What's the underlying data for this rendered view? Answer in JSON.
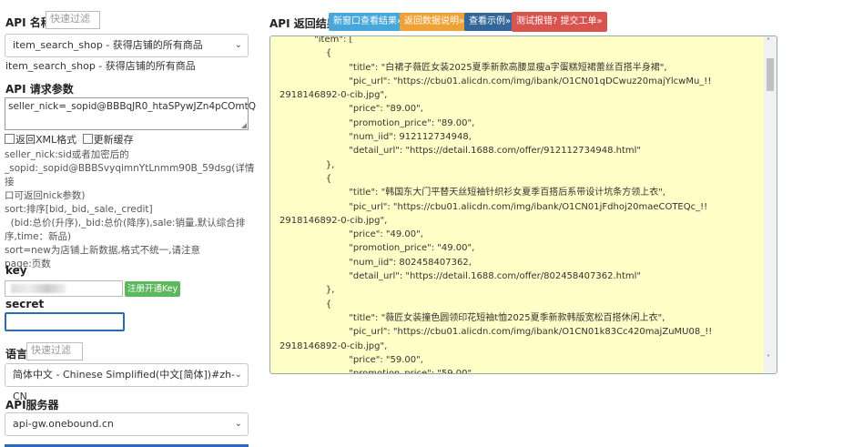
{
  "api_name": {
    "label": "API 名称",
    "filter_placeholder": "快速过滤",
    "selected": "item_search_shop - 获得店铺的所有商品",
    "description": "item_search_shop - 获得店铺的所有商品"
  },
  "params": {
    "label": "API 请求参数",
    "value": "seller_nick=_sopid@BBBqJR0_htaSPywJZn4pCOmtQ",
    "xml_label": "返回XML格式",
    "refresh_label": "更新缓存",
    "help_lines": [
      "seller_nick:sid或者加密后的",
      "_sopid:_sopid@BBBSvyqimnYtLnmm90B_59dsg(详情接",
      "口可返回nick参数)",
      "sort:排序[bid,_bid,_sale,_credit]",
      "  (bid:总价(升序),_bid:总价(降序),sale:销量,默认综合排",
      "序,time：新品)",
      "sort=new为店铺上新数据,格式不统一,请注意",
      "page:页数"
    ]
  },
  "key": {
    "label": "key",
    "register_label": "注册开通Key"
  },
  "secret": {
    "label": "secret"
  },
  "language": {
    "label": "语言",
    "filter_placeholder": "快速过滤",
    "selected": "简体中文 - Chinese Simplified(中文[简体])#zh-CN"
  },
  "server": {
    "label": "API服务器",
    "selected": "api-gw.onebound.cn"
  },
  "result": {
    "label": "API 返回结果",
    "btn_new_window": "新窗口查看结果»",
    "btn_return_docs": "返回数据说明»",
    "btn_example": "查看示例»",
    "btn_report": "测试报错? 提交工单»",
    "content": "            \"item\": [\n                {\n                        \"title\": \"白裙子薇匠女装2025夏季新款高腰显瘦a字蛋糕短裙蕾丝百搭半身裙\",\n                        \"pic_url\": \"https://cbu01.alicdn.com/img/ibank/O1CN01qDCwuz20majYlcwMu_!!\n2918146892-0-cib.jpg\",\n                        \"price\": \"89.00\",\n                        \"promotion_price\": \"89.00\",\n                        \"num_iid\": 912112734948,\n                        \"detail_url\": \"https://detail.1688.com/offer/912112734948.html\"\n                },\n                {\n                        \"title\": \"韩国东大门平替天丝短袖针织衫女夏季百搭后系带设计坑条方领上衣\",\n                        \"pic_url\": \"https://cbu01.alicdn.com/img/ibank/O1CN01jFdhoj20maeCOTEQc_!!\n2918146892-0-cib.jpg\",\n                        \"price\": \"49.00\",\n                        \"promotion_price\": \"49.00\",\n                        \"num_iid\": 802458407362,\n                        \"detail_url\": \"https://detail.1688.com/offer/802458407362.html\"\n                },\n                {\n                        \"title\": \"薇匠女装撞色圆领印花短袖t恤2025夏季新款韩版宽松百搭休闲上衣\",\n                        \"pic_url\": \"https://cbu01.alicdn.com/img/ibank/O1CN01k83Cc420majZuMU08_!!\n2918146892-0-cib.jpg\",\n                        \"price\": \"59.00\",\n                        \"promotion_price\": \"59.00\","
  },
  "colors": {
    "btn_blue": "#46a7d8",
    "btn_orange": "#eea236",
    "btn_dark": "#336699",
    "btn_red": "#d9534f",
    "result_bg": "#ffffc7",
    "register_green": "#5cb85c"
  }
}
